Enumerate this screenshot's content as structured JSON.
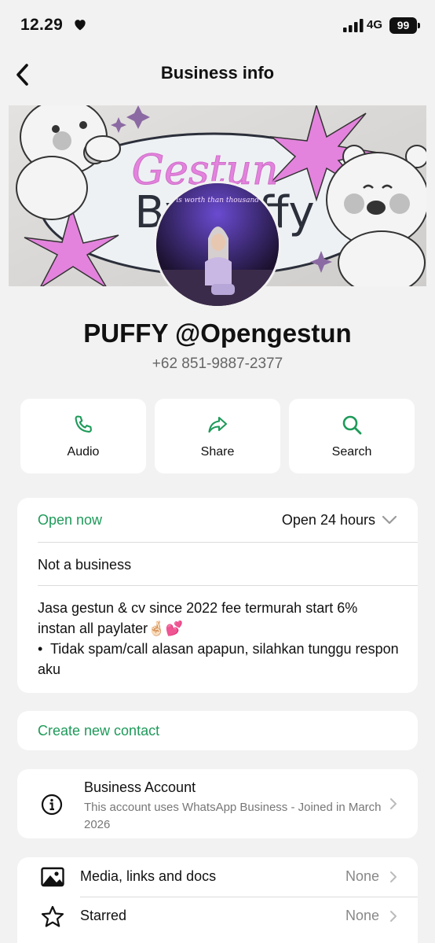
{
  "status_bar": {
    "time": "12.29",
    "network": "4G",
    "battery": "99"
  },
  "header": {
    "title": "Business info"
  },
  "profile": {
    "name": "PUFFY @Opengestun",
    "phone": "+62 851-9887-2377",
    "banner_text_top": "Gestun",
    "banner_text_main": "By Puffy",
    "neon_text": "future is worth than thousand words"
  },
  "actions": [
    {
      "label": "Audio",
      "icon": "phone-icon"
    },
    {
      "label": "Share",
      "icon": "share-icon"
    },
    {
      "label": "Search",
      "icon": "search-icon"
    }
  ],
  "hours": {
    "status": "Open now",
    "value": "Open 24 hours"
  },
  "category": "Not a business",
  "description": [
    "Jasa gestun & cv since 2022 fee termurah start 6% instan all paylater🤞🏻💕",
    "•  Tidak spam/call alasan apapun, silahkan tunggu respon aku"
  ],
  "create_contact": "Create new contact",
  "business_account": {
    "title": "Business Account",
    "subtitle": "This account uses WhatsApp Business - Joined in March 2026"
  },
  "media": [
    {
      "label": "Media, links and docs",
      "value": "None",
      "icon": "image-icon"
    },
    {
      "label": "Starred",
      "value": "None",
      "icon": "star-icon"
    }
  ],
  "colors": {
    "accent": "#1e9a5a",
    "background": "#f2f2f2",
    "star_pink": "#e383dd"
  }
}
